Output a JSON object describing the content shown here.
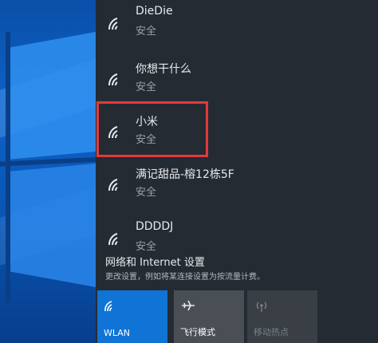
{
  "networks": [
    {
      "name": "DieDie",
      "status": "安全"
    },
    {
      "name": "你想干什么",
      "status": "安全"
    },
    {
      "name": "小米",
      "status": "安全"
    },
    {
      "name": "满记甜品-榕12栋5F",
      "status": "安全"
    },
    {
      "name": "DDDDJ",
      "status": "安全"
    }
  ],
  "settings": {
    "link": "网络和 Internet 设置",
    "description": "更改设置，例如将某连接设置为按流量计费。"
  },
  "tiles": [
    {
      "label": "WLAN",
      "icon": "wifi-icon"
    },
    {
      "label": "飞行模式",
      "icon": "airplane-icon"
    },
    {
      "label": "移动热点",
      "icon": "hotspot-icon"
    }
  ],
  "colors": {
    "flyout_bg": "#252b33",
    "accent": "#0f74d6",
    "highlight": "#e23a3a"
  }
}
